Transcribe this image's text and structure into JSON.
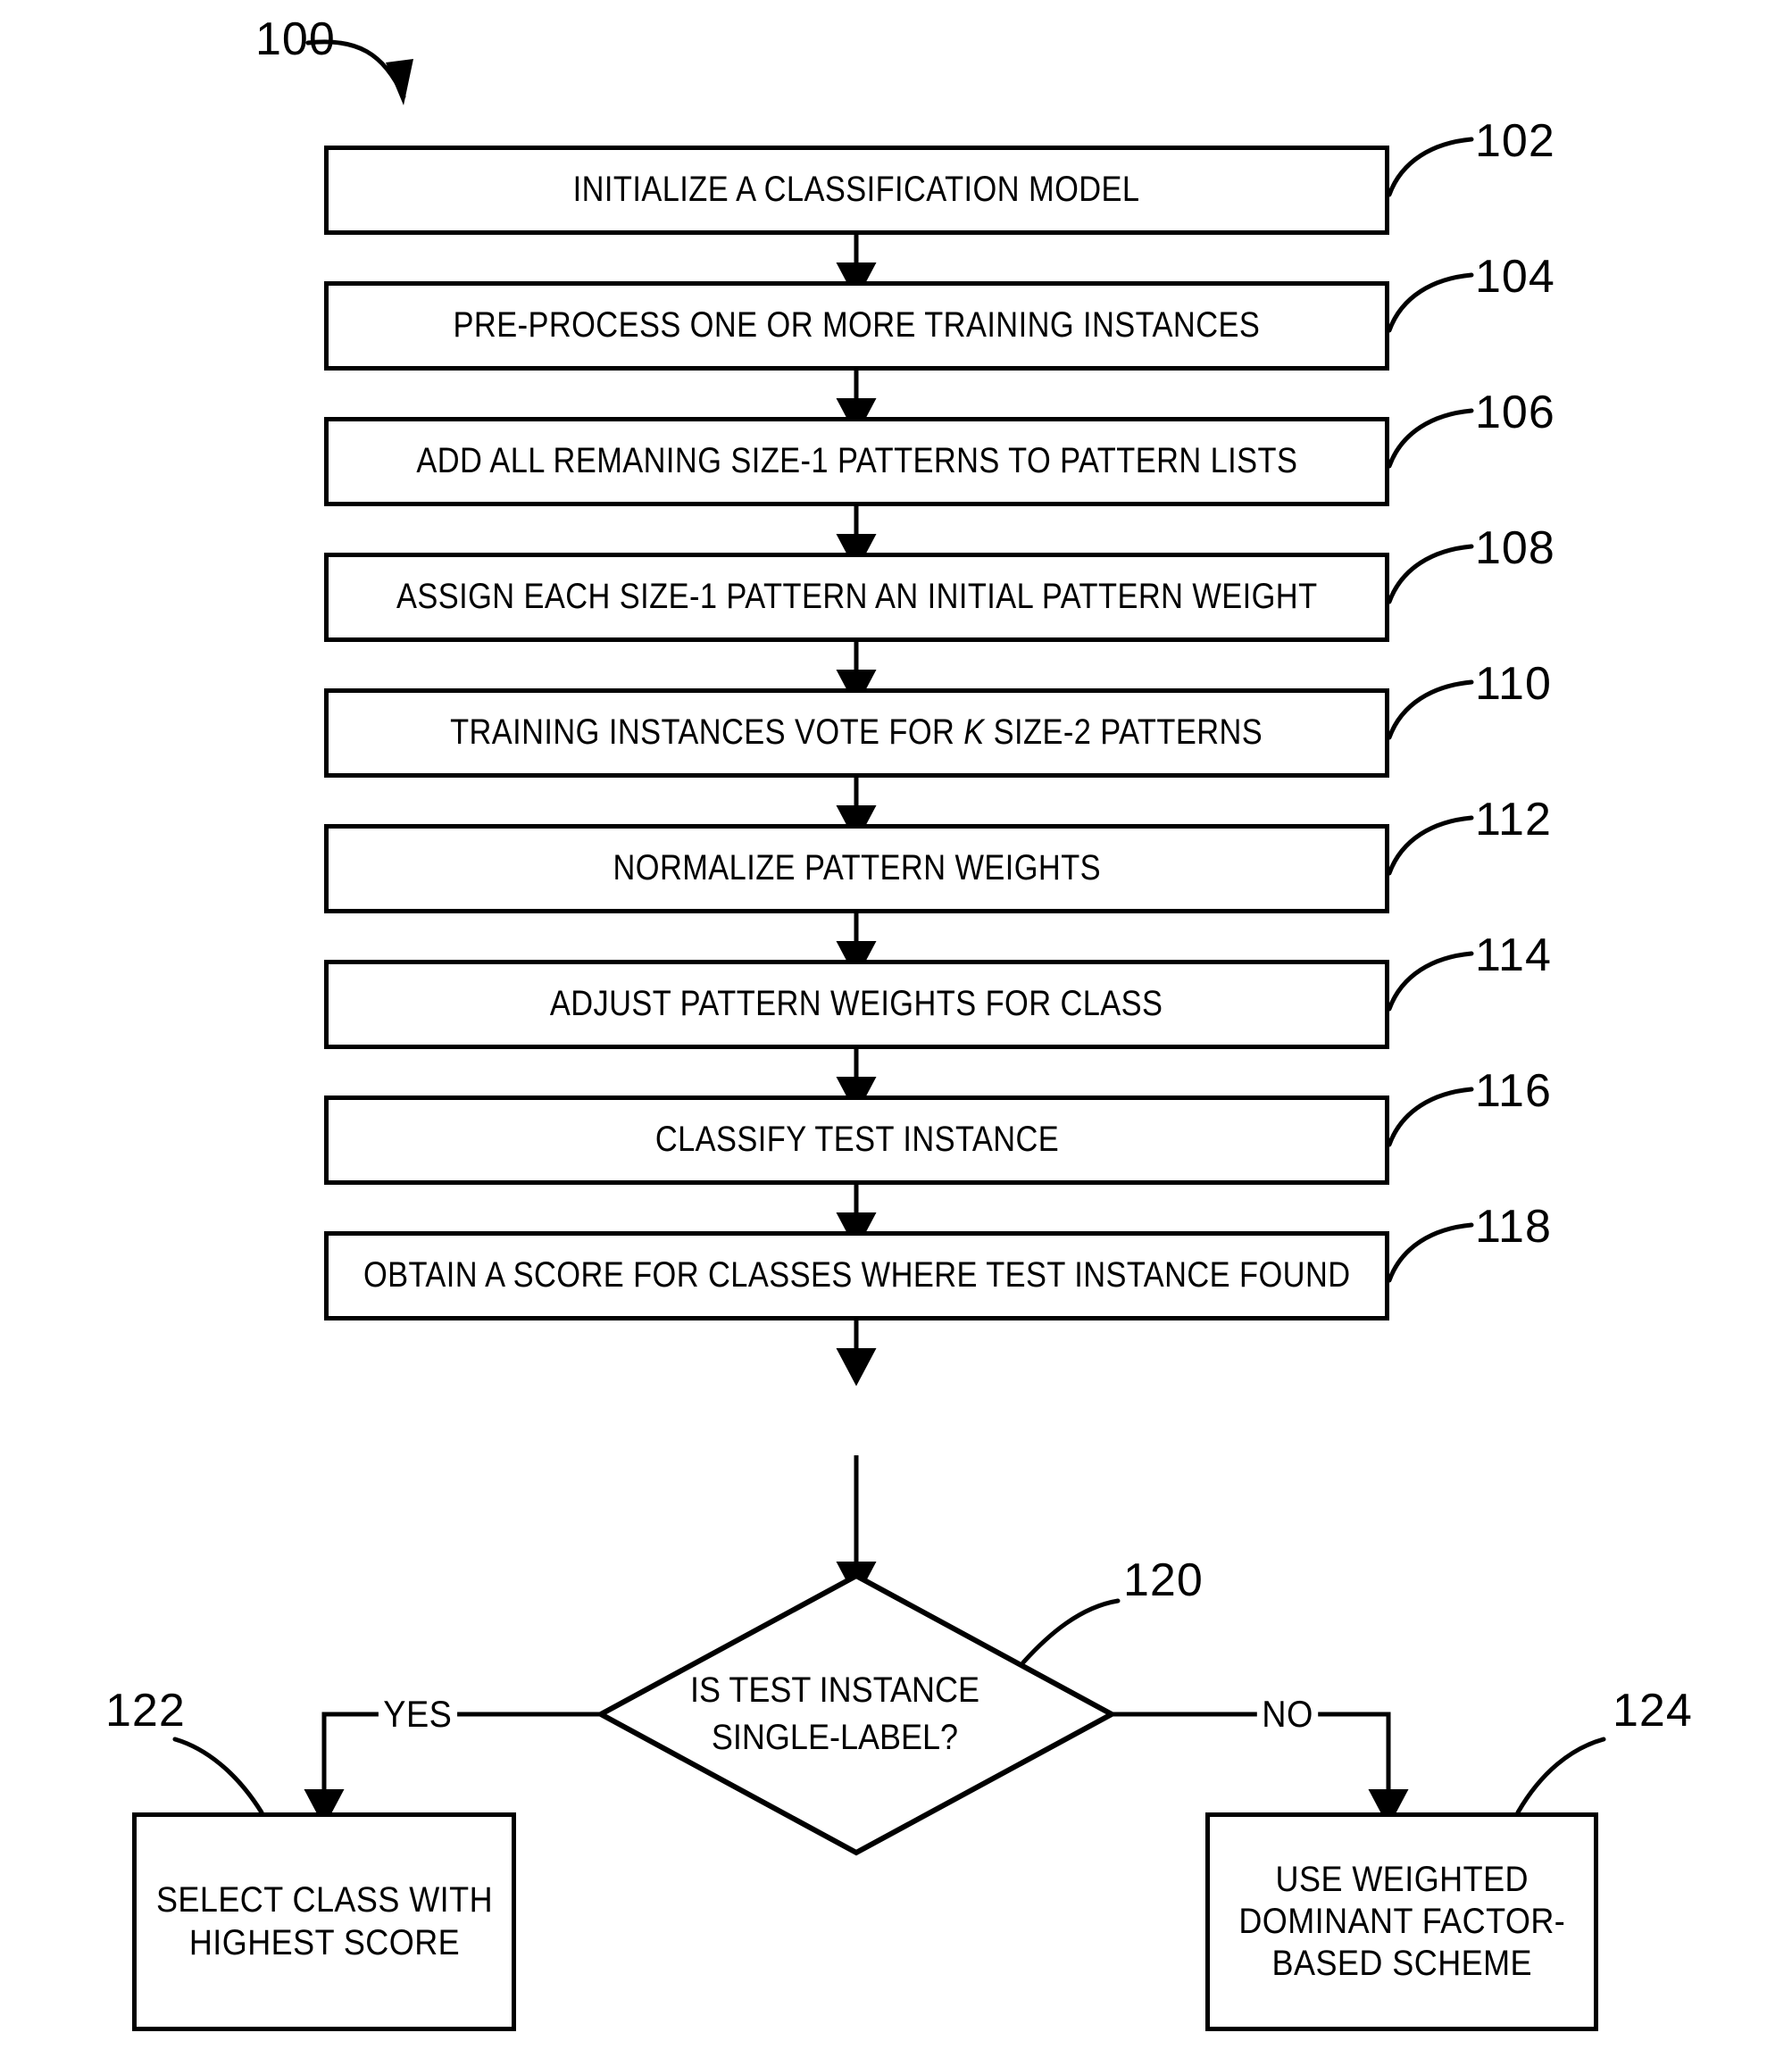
{
  "figure": {
    "label": "100",
    "type": "patent-flowchart"
  },
  "steps": [
    {
      "ref": "102",
      "text": "INITIALIZE A CLASSIFICATION MODEL"
    },
    {
      "ref": "104",
      "text": "PRE-PROCESS ONE OR MORE TRAINING INSTANCES"
    },
    {
      "ref": "106",
      "text": "ADD ALL REMANING SIZE-1 PATTERNS TO PATTERN LISTS"
    },
    {
      "ref": "108",
      "text": "ASSIGN EACH SIZE-1 PATTERN AN INITIAL PATTERN WEIGHT"
    },
    {
      "ref": "110",
      "text_before": "TRAINING INSTANCES VOTE FOR ",
      "italic": "K",
      "text_after": " SIZE-2 PATTERNS"
    },
    {
      "ref": "112",
      "text": "NORMALIZE PATTERN WEIGHTS"
    },
    {
      "ref": "114",
      "text": "ADJUST PATTERN WEIGHTS FOR CLASS"
    },
    {
      "ref": "116",
      "text": "CLASSIFY TEST INSTANCE"
    },
    {
      "ref": "118",
      "text": "OBTAIN A SCORE FOR CLASSES WHERE TEST INSTANCE FOUND"
    }
  ],
  "decision": {
    "ref": "120",
    "line1": "IS TEST INSTANCE",
    "line2": "SINGLE-LABEL?",
    "yes_label": "YES",
    "no_label": "NO"
  },
  "outcomes": [
    {
      "ref": "122",
      "line1": "SELECT CLASS WITH",
      "line2": "HIGHEST SCORE"
    },
    {
      "ref": "124",
      "line1": "USE WEIGHTED",
      "line2": "DOMINANT FACTOR-",
      "line3": "BASED SCHEME"
    }
  ],
  "style": {
    "ink": "#000000",
    "paper": "#ffffff"
  }
}
